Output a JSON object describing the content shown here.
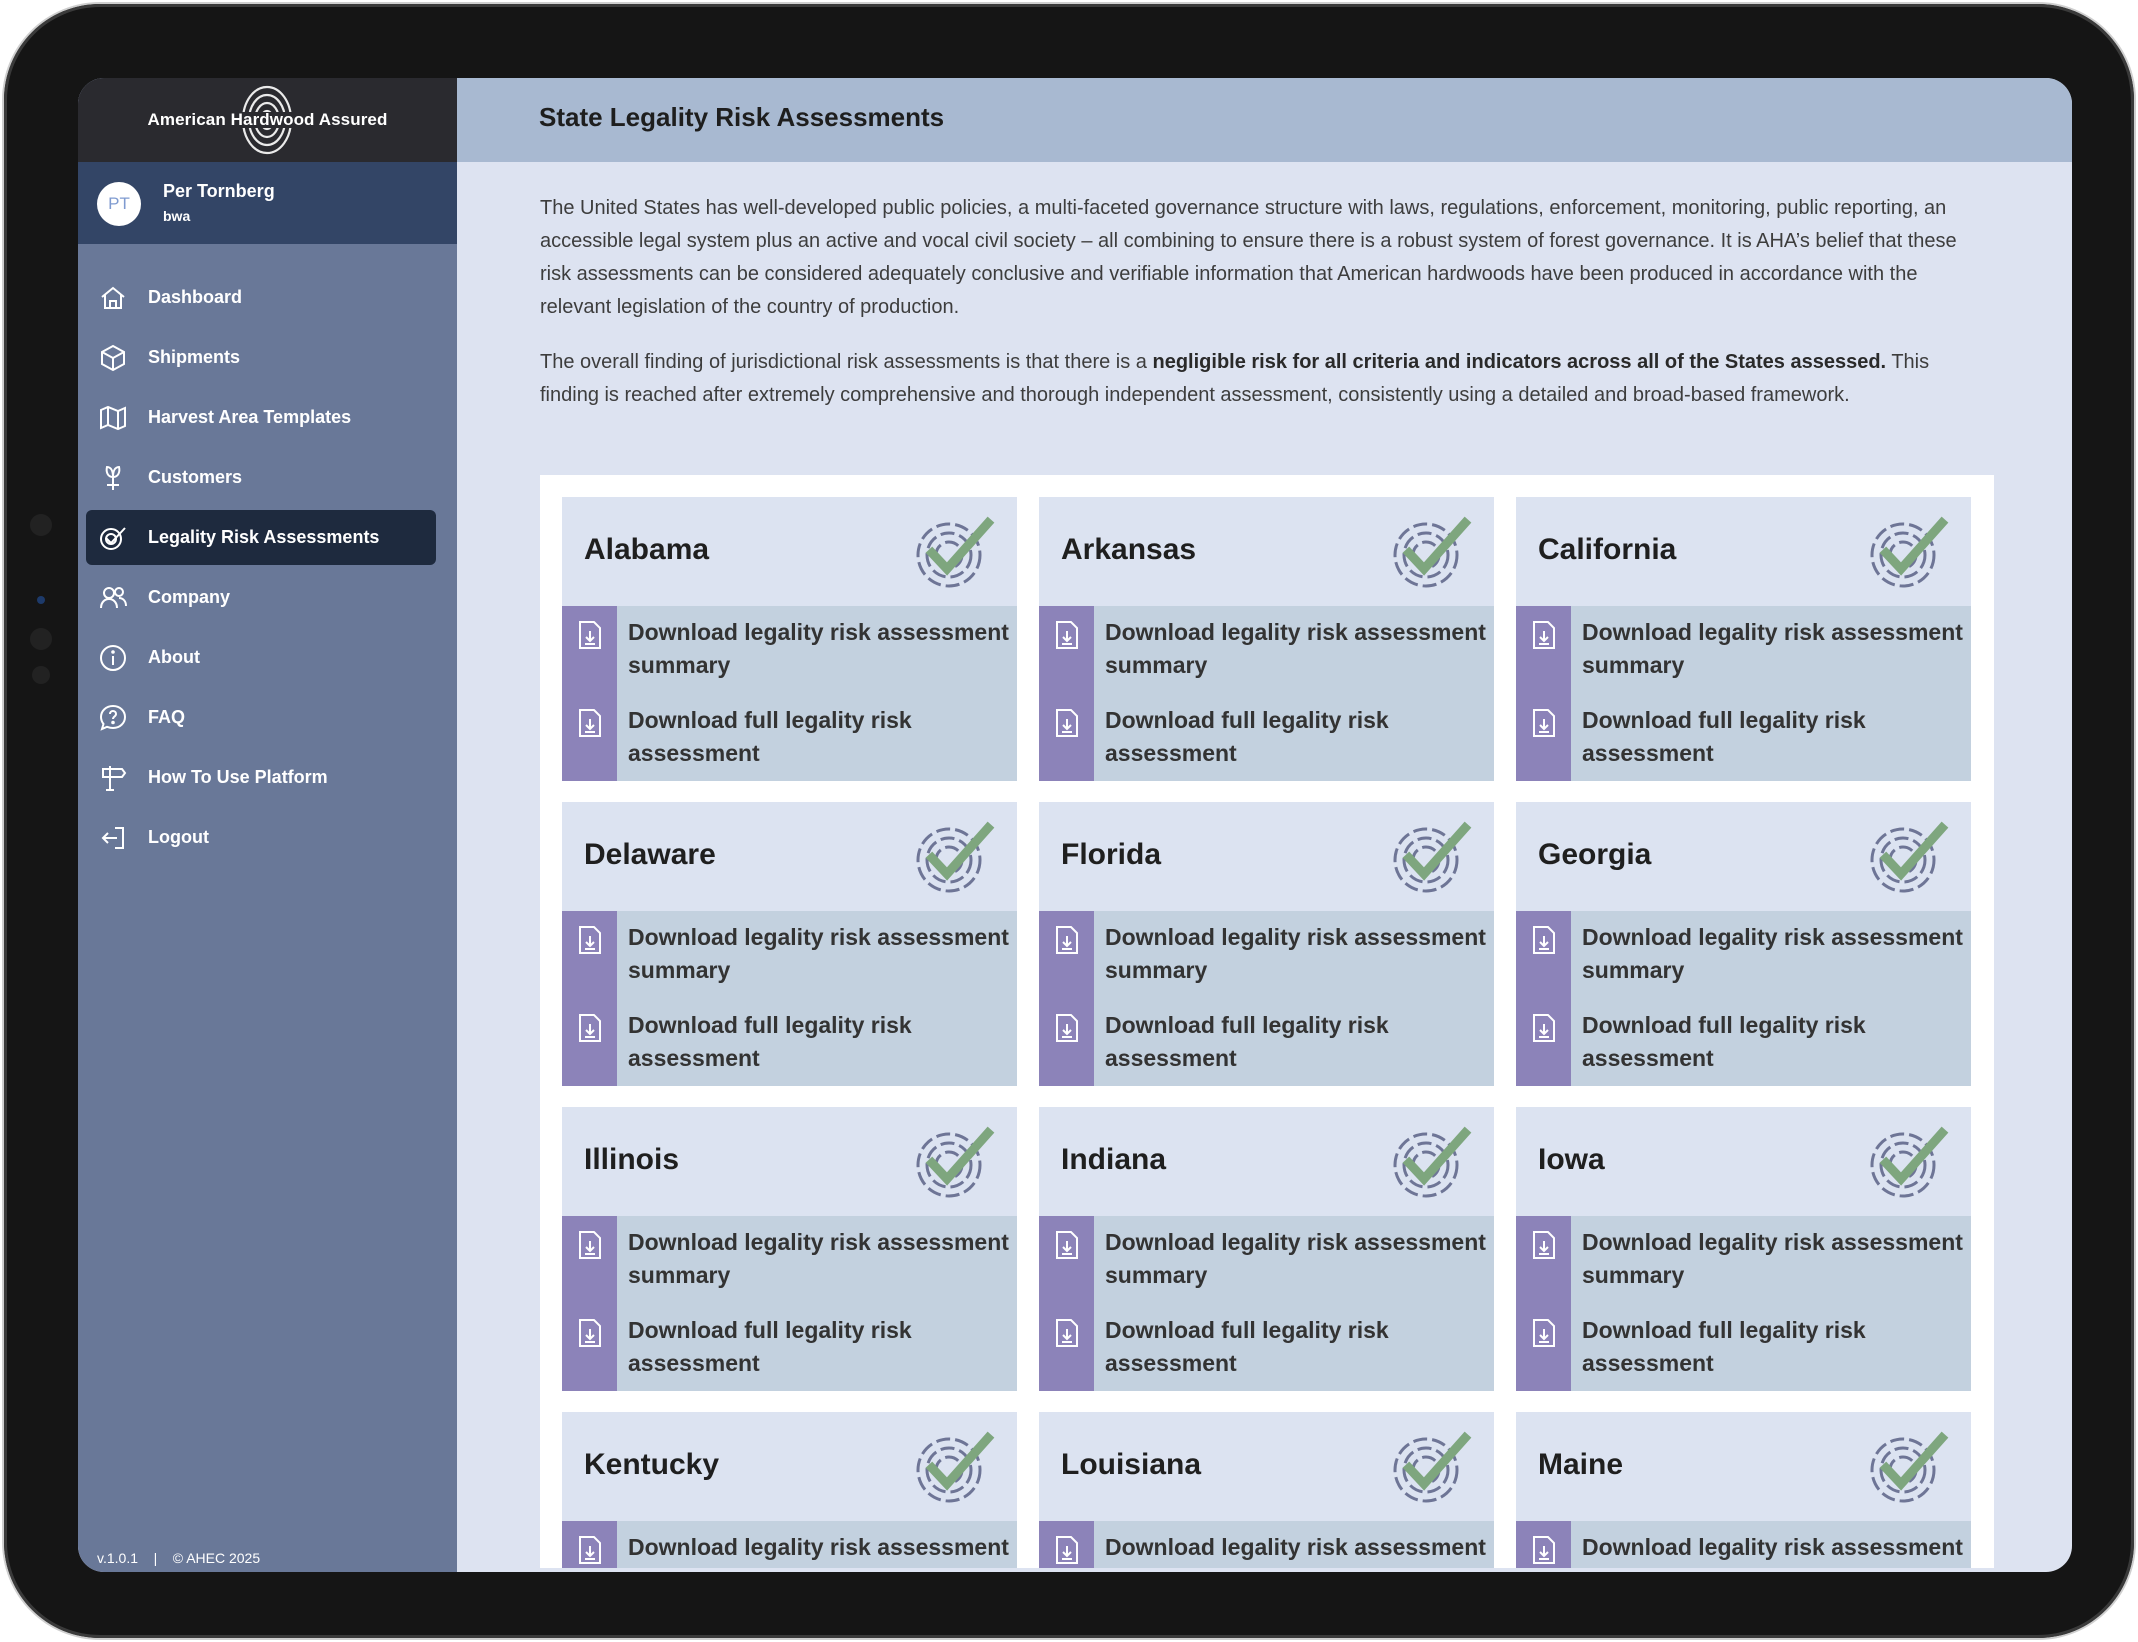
{
  "app": {
    "brand": "American Hardwood Assured",
    "user": {
      "initials": "PT",
      "name": "Per Tornberg",
      "org": "bwa"
    },
    "footer": {
      "version": "v.1.0.1",
      "separator": "|",
      "copyright": "© AHEC 2025"
    }
  },
  "sidebar": {
    "items": [
      {
        "label": "Dashboard",
        "icon": "home-icon",
        "active": false
      },
      {
        "label": "Shipments",
        "icon": "box-icon",
        "active": false
      },
      {
        "label": "Harvest Area Templates",
        "icon": "map-icon",
        "active": false
      },
      {
        "label": "Customers",
        "icon": "plant-hand-icon",
        "active": false
      },
      {
        "label": "Legality Risk Assessments",
        "icon": "shield-check-icon",
        "active": true
      },
      {
        "label": "Company",
        "icon": "users-icon",
        "active": false
      },
      {
        "label": "About",
        "icon": "info-icon",
        "active": false
      },
      {
        "label": "FAQ",
        "icon": "question-bubble-icon",
        "active": false
      },
      {
        "label": "How To Use Platform",
        "icon": "signpost-icon",
        "active": false
      },
      {
        "label": "Logout",
        "icon": "logout-icon",
        "active": false
      }
    ]
  },
  "main": {
    "title": "State Legality Risk Assessments",
    "intro_p1": "The United States has well-developed public policies, a multi-faceted governance structure with laws, regulations, enforcement, monitoring, public reporting, an accessible legal system plus an active and vocal civil society – all combining to ensure there is a robust system of forest governance. It is AHA’s belief that these risk assessments can be considered adequately conclusive and verifiable information that American hardwoods have been produced in accordance with the relevant legislation of the country of production.",
    "intro_p2_before": "The overall finding of jurisdictional risk assessments is that there is a ",
    "intro_p2_bold": "negligible risk for all criteria and indicators across all of the States assessed.",
    "intro_p2_after": " This finding is reached after extremely comprehensive and thorough independent assessment, consistently using a detailed and broad-based framework.",
    "download_summary_label": "Download legality risk assessment summary",
    "download_full_label": "Download full legality risk assessment",
    "states": [
      "Alabama",
      "Arkansas",
      "California",
      "Delaware",
      "Florida",
      "Georgia",
      "Illinois",
      "Indiana",
      "Iowa",
      "Kentucky",
      "Louisiana",
      "Maine"
    ]
  },
  "colors": {
    "sidebar": "#697898",
    "brand_bar": "#2a2a2f",
    "user_bar": "#334566",
    "active_item": "#1e2a3e",
    "topbar": "#a8b9d1",
    "content_bg": "#dde3f1",
    "card_bg": "#dce3f1",
    "card_body": "#c3d1df",
    "card_strip": "#8c83b9",
    "check_green": "#7ea67e"
  }
}
